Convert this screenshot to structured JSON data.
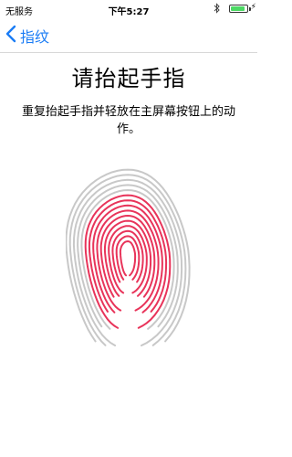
{
  "status_bar": {
    "carrier": "无服务",
    "time": "下午5:27",
    "battery_level": 0.9,
    "bluetooth_icon": "bluetooth-icon",
    "charging_icon": "charging-bolt-icon"
  },
  "nav": {
    "back_label": "指纹",
    "back_icon": "chevron-left-icon"
  },
  "main": {
    "title": "请抬起手指",
    "instruction": "重复抬起手指并轻放在主屏幕按钮上的动作。"
  },
  "fingerprint": {
    "icon": "fingerprint-icon",
    "active_color": "#e8345a",
    "inactive_color": "#c8c8c8",
    "progress": 0.5
  },
  "colors": {
    "accent": "#1a7cf5"
  }
}
